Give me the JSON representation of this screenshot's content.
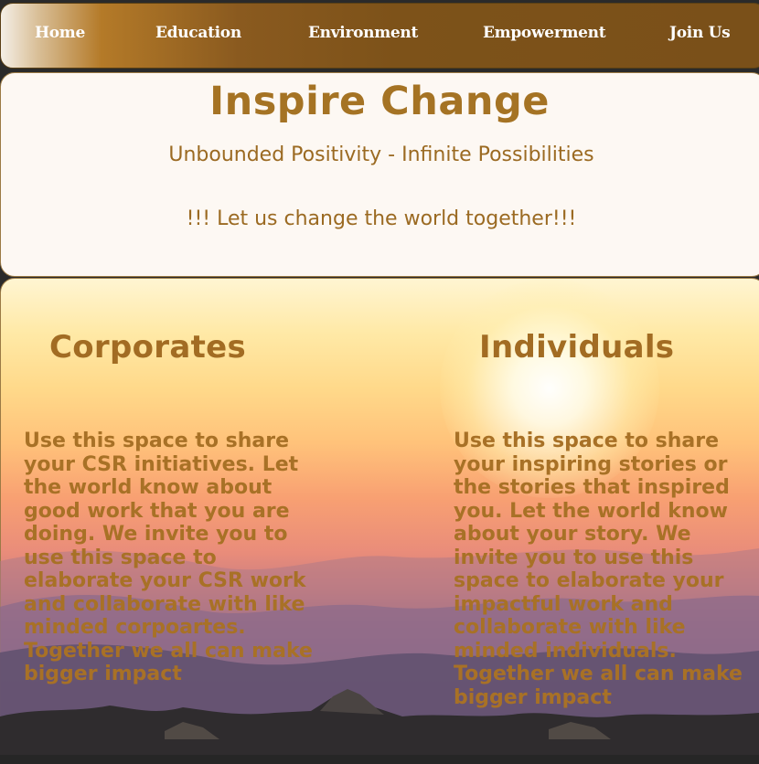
{
  "nav": {
    "items": [
      "Home",
      "Education",
      "Environment",
      "Empowerment",
      "Join Us"
    ]
  },
  "hero": {
    "title": "Inspire Change",
    "subtitle": "Unbounded Positivity - Infinite Possibilities",
    "cta": "!!! Let us change the world together!!!"
  },
  "sections": {
    "corporates": {
      "heading": "Corporates",
      "text": "Use this space to share your CSR initiatives. Let the world know about good work that you are doing. We invite you to use this space to elaborate your CSR work and collaborate with like minded corpoartes. Together we all can make bigger impact"
    },
    "individuals": {
      "heading": "Individuals",
      "text": "Use this space to share your inspiring stories or the stories that inspired you. Let the world know about your story. We invite you to use this space to elaborate your impactful work and collaborate with like minded individuals. Together we all can make bigger impact"
    }
  },
  "colors": {
    "brand_brown": "#7d5219",
    "text_gold": "#a57324",
    "hero_bg": "#fdf8f3"
  }
}
